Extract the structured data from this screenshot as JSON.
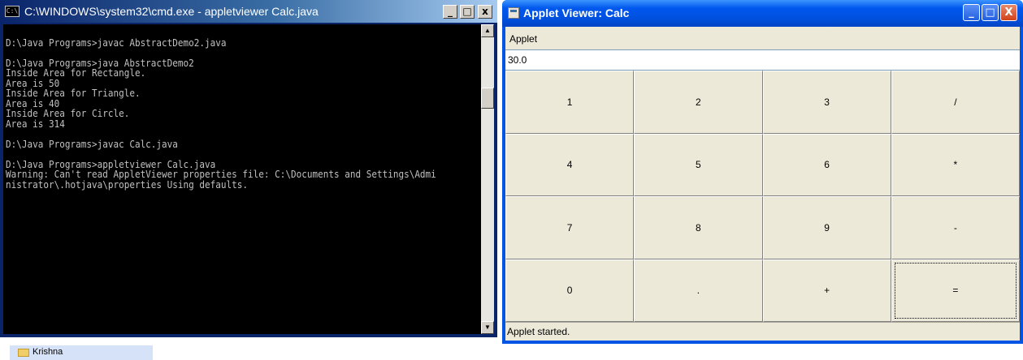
{
  "cmd": {
    "title": "C:\\WINDOWS\\system32\\cmd.exe - appletviewer Calc.java",
    "icon_text": "C:\\",
    "minimize_symbol": "_",
    "restore_symbol": "□",
    "close_symbol": "x",
    "output": "\nD:\\Java Programs>javac AbstractDemo2.java\n\nD:\\Java Programs>java AbstractDemo2\nInside Area for Rectangle.\nArea is 50\nInside Area for Triangle.\nArea is 40\nInside Area for Circle.\nArea is 314\n\nD:\\Java Programs>javac Calc.java\n\nD:\\Java Programs>appletviewer Calc.java\nWarning: Can't read AppletViewer properties file: C:\\Documents and Settings\\Admi\nnistrator\\.hotjava\\properties Using defaults.",
    "scroll_up_symbol": "▲",
    "scroll_down_symbol": "▼"
  },
  "applet": {
    "title": "Applet Viewer: Calc",
    "minimize_symbol": "_",
    "maximize_symbol": "□",
    "close_symbol": "X",
    "menu_label": "Applet",
    "display_value": "30.0",
    "buttons": [
      "1",
      "2",
      "3",
      "/",
      "4",
      "5",
      "6",
      "*",
      "7",
      "8",
      "9",
      "-",
      "0",
      ".",
      "+",
      "="
    ],
    "status": "Applet started."
  },
  "explorer": {
    "folder_label": "Krishna"
  },
  "colors": {
    "cmd_background": "#000000",
    "cmd_text": "#c0c0c0",
    "xp_titlebar": "#0054e3",
    "applet_face": "#ece9d8"
  }
}
